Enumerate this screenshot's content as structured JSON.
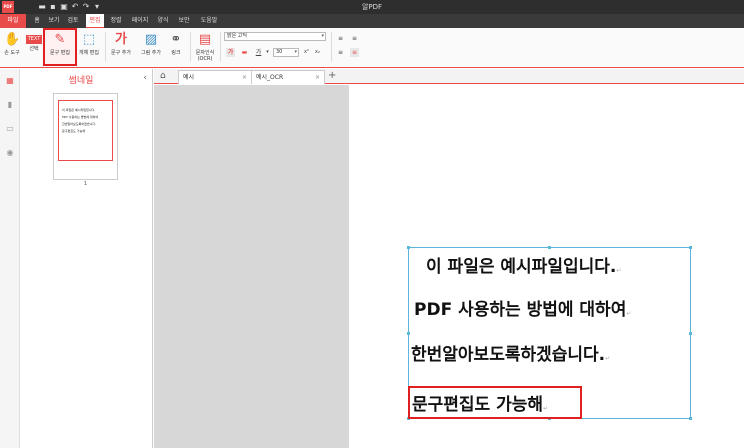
{
  "window": {
    "title": "알PDF",
    "logo_text": "PDF"
  },
  "quick_access": [
    {
      "icon": "folder-icon",
      "glyph": "▬"
    },
    {
      "icon": "save-icon",
      "glyph": "▪"
    },
    {
      "icon": "print-icon",
      "glyph": "▣"
    },
    {
      "icon": "undo-icon",
      "glyph": "↶"
    },
    {
      "icon": "redo-icon",
      "glyph": "↷"
    },
    {
      "icon": "customize-icon",
      "glyph": "▾"
    }
  ],
  "menu": {
    "items": [
      {
        "label": "파일",
        "state": "active"
      },
      {
        "label": "홈",
        "state": ""
      },
      {
        "label": "보기",
        "state": ""
      },
      {
        "label": "검토",
        "state": ""
      },
      {
        "label": "편집",
        "state": "current"
      },
      {
        "label": "정렬",
        "state": ""
      },
      {
        "label": "페이지",
        "state": ""
      },
      {
        "label": "양식",
        "state": ""
      },
      {
        "label": "보안",
        "state": ""
      },
      {
        "label": "도움말",
        "state": ""
      }
    ]
  },
  "ribbon": {
    "hand_tool": "손 도구",
    "select": "선택",
    "select_badge": "TEXT",
    "text_edit": "문구 편집",
    "object_edit": "개체 편집",
    "add_text": "문구 추가",
    "add_image": "그림 추가",
    "link": "링크",
    "ocr": "문자인식",
    "ocr_sub": "(OCR)",
    "font_name": "맑은 고딕",
    "font_size": "30",
    "bold_glyph": "가",
    "font_color_glyph": "가",
    "superscript": "x²",
    "subscript": "x₂",
    "font_grow": "▲",
    "font_shrink": "▼"
  },
  "thumbnail_panel": {
    "title": "썸네일",
    "page_number": "1",
    "preview_lines": [
      "이 파일은 예시파일입니다.",
      "PDF 사용하는 방법에 대하여",
      "한번알아보도록하겠습니다.",
      "문구편집도 가능해"
    ]
  },
  "tabs": [
    {
      "label": "예시",
      "close": "×"
    },
    {
      "label": "예시_OCR",
      "close": "×"
    }
  ],
  "tab_add": "+",
  "document": {
    "lines": [
      "이 파일은 예시파일입니다.",
      "PDF 사용하는 방법에 대하여",
      "한번알아보도록하겠습니다.",
      "문구편집도 가능해"
    ]
  },
  "colors": {
    "accent": "#e94a4a",
    "highlight_box": "#e02020",
    "selection": "#5bb6d9"
  }
}
